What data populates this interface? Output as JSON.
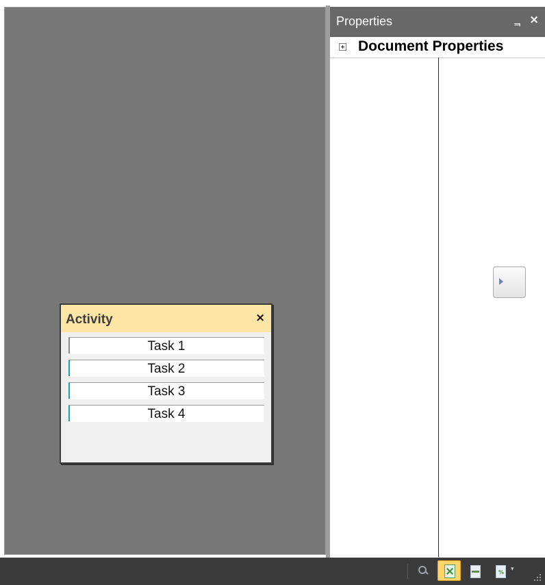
{
  "properties_panel": {
    "title": "Properties",
    "pin_glyph": "ᆿ",
    "close_glyph": "×",
    "row_label": "Document Properties",
    "expand_icon": "plus-box-icon",
    "scroll_button_icon": "arrow-right-icon"
  },
  "activity_window": {
    "title": "Activity",
    "close_glyph": "×",
    "header_color": "#fde6a5",
    "tasks": [
      {
        "label": "Task 1",
        "active": false
      },
      {
        "label": "Task 2",
        "active": true
      },
      {
        "label": "Task 3",
        "active": true
      },
      {
        "label": "Task 4",
        "active": true
      }
    ]
  },
  "status_bar": {
    "icons": [
      "search-icon",
      "fit-page-icon",
      "fit-width-icon",
      "zoom-page-icon"
    ],
    "selected_icon": "fit-page-icon",
    "zoom_mark": "%",
    "dropdown_glyph": "▾"
  },
  "colors": {
    "canvas": "#777777",
    "panel_header": "#686868",
    "status_bar": "#3b3b3b",
    "task_progress": "#16a0b8",
    "selected_tool": "#ffd56b"
  }
}
